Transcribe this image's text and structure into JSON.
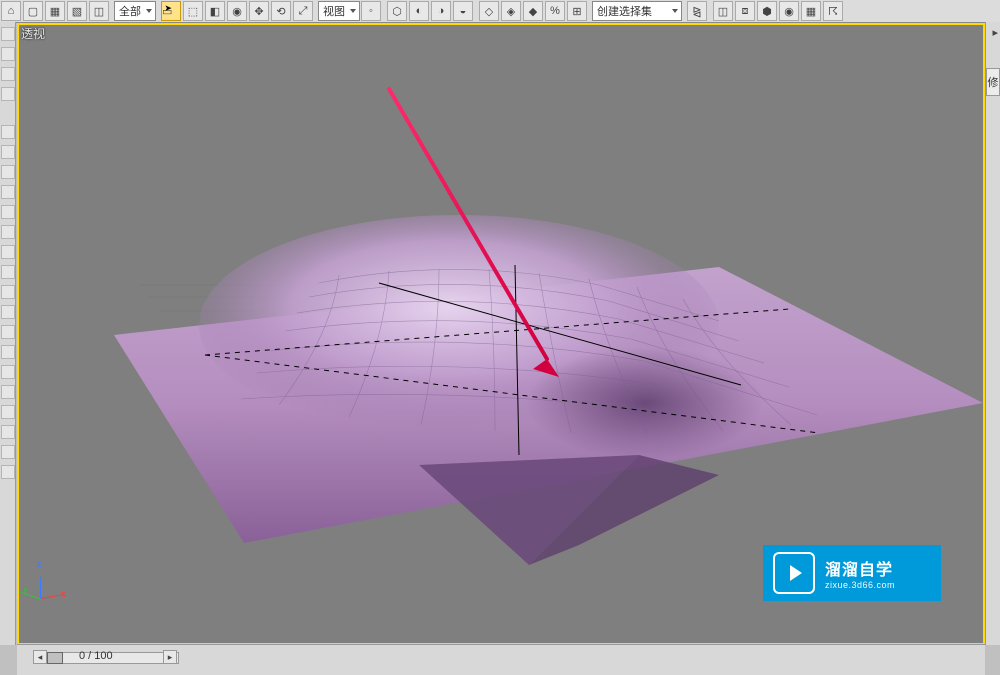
{
  "top_toolbar": {
    "dropdown1_label": "全部",
    "dropdown2_label": "视图",
    "dropdown3_label": "创建选择集"
  },
  "viewport": {
    "label": "透视"
  },
  "status": {
    "frame_readout": "0  /  100"
  },
  "watermark": {
    "title": "溜溜自学",
    "subtitle": "zixue.3d66.com"
  },
  "right_panel": {
    "rollout_label": "修"
  },
  "axis": {
    "x": "x",
    "y": "y",
    "z": "z"
  },
  "colors": {
    "viewport_bg": "#7f7f7f",
    "selection_yellow": "#ffd900",
    "plane_purple_light": "#b98fc4",
    "plane_purple_dark": "#8a5e9a",
    "annotation_arrow": "#e4004f",
    "watermark_bg": "#0099d9"
  }
}
